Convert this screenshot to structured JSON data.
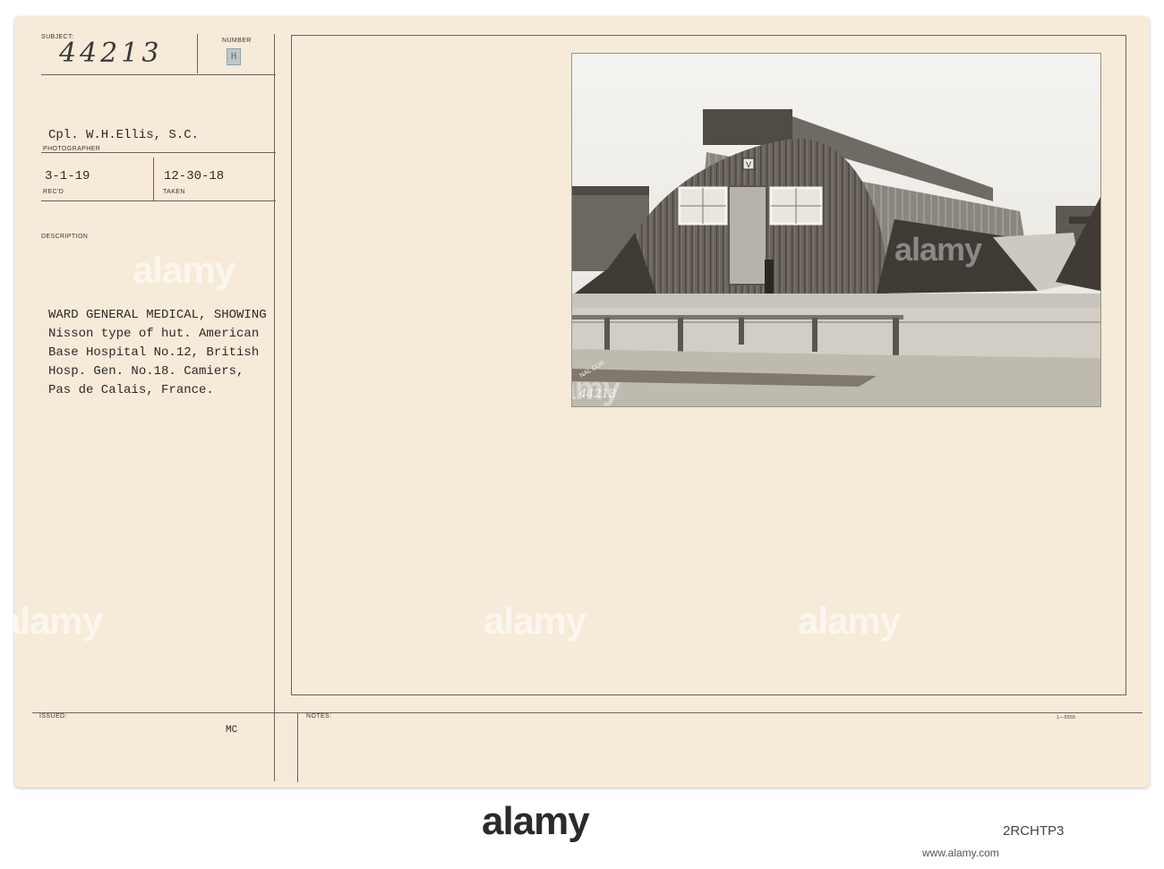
{
  "record": {
    "subject_label": "SUBJECT:",
    "subject_value": "44213",
    "number_label": "NUMBER",
    "number_stamp": "H",
    "photographer_value": "Cpl. W.H.Ellis, S.C.",
    "photographer_label": "PHOTOGRAPHER",
    "recd_value": "3-1-19",
    "recd_label": "REC'D",
    "taken_value": "12-30-18",
    "taken_label": "TAKEN",
    "description_label": "DESCRIPTION",
    "description_text": "WARD GENERAL MEDICAL, SHOWING\nNisson type of hut. American\nBase Hospital No.12, British\nHosp. Gen. No.18. Camiers,\nPas de Calais, France.",
    "issued_label": "ISSUED:",
    "issued_value": "MC",
    "notes_label": "NOTES:",
    "form_number": "1—5055"
  },
  "photo": {
    "sign_letter": "V",
    "plate_number": "44213",
    "corner_stamp": "NAL COR"
  },
  "watermarks": {
    "text": "alamy"
  },
  "footer": {
    "brand": "alamy",
    "image_id": "2RCHTP3",
    "tagline": "www.alamy.com"
  }
}
